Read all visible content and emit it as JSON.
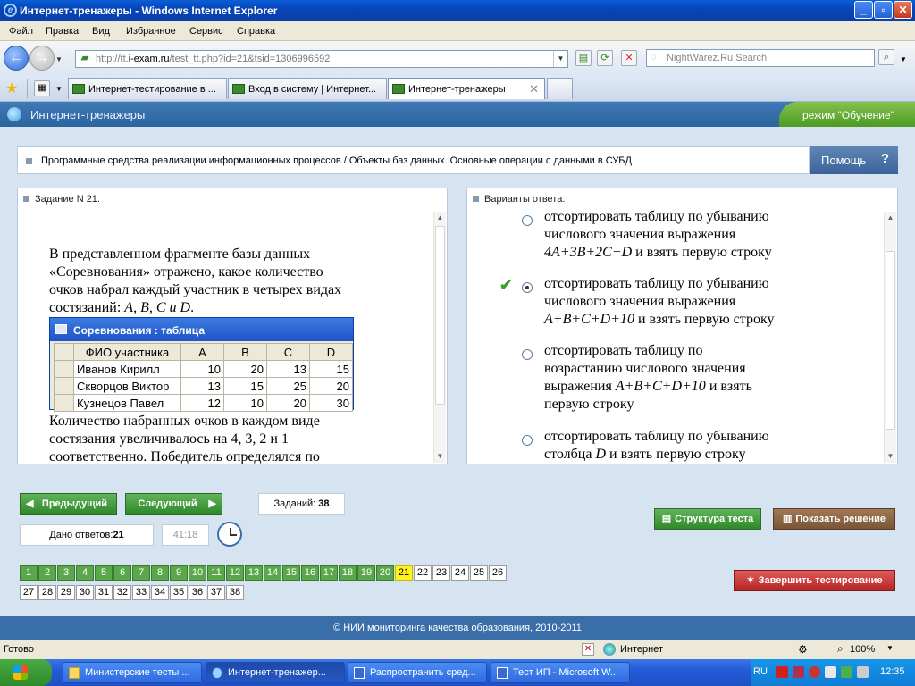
{
  "window": {
    "title": "Интернет-тренажеры - Windows Internet Explorer"
  },
  "menu": [
    "Файл",
    "Правка",
    "Вид",
    "Избранное",
    "Сервис",
    "Справка"
  ],
  "address": {
    "prefix": "http://tt.",
    "host": "i-exam.ru",
    "path": "/test_tt.php?id=21&tsid=1306996592"
  },
  "search": {
    "placeholder": "NightWarez.Ru Search"
  },
  "tabs": [
    {
      "label": "Интернет-тестирование в ..."
    },
    {
      "label": "Вход в систему | Интернет..."
    },
    {
      "label": "Интернет-тренажеры"
    }
  ],
  "app": {
    "title": "Интернет-тренажеры",
    "mode": "режим \"Обучение\""
  },
  "breadcrumb": "Программные средства реализации информационных процессов / Объекты баз данных. Основные операции с данными в СУБД",
  "help_label": "Помощь",
  "task": {
    "header": "Задание N 21.",
    "text_lines": [
      "В представленном  фрагменте базы данных",
      "«Соревнования» отражено, какое количество",
      "очков набрал каждый участник в четырех видах"
    ],
    "text_line4_prefix": "состязаний: ",
    "text_line4_math": "A, B, C и D",
    "text_line4_suffix": ".",
    "after_lines": [
      "Количество набранных очков в каждом виде",
      "состязания увеличивалось на 4, 3, 2 и 1",
      "соответственно. Победитель определялся по"
    ]
  },
  "table": {
    "title": "Соревнования : таблица",
    "columns": [
      "ФИО участника",
      "A",
      "B",
      "C",
      "D"
    ],
    "rows": [
      [
        "Иванов Кирилл",
        "10",
        "20",
        "13",
        "15"
      ],
      [
        "Скворцов Виктор",
        "13",
        "15",
        "25",
        "20"
      ],
      [
        "Кузнецов Павел",
        "12",
        "10",
        "20",
        "30"
      ]
    ]
  },
  "answers": {
    "header": "Варианты ответа:",
    "options": [
      {
        "l1": "отсортировать таблицу по убыванию",
        "l2": "числового значения выражения",
        "l3m": "4A+3B+2C+D",
        "l3s": " и взять первую строку",
        "selected": false
      },
      {
        "l1": "отсортировать таблицу по убыванию",
        "l2": "числового значения выражения",
        "l3m": "A+B+C+D+10",
        "l3s": " и взять первую строку",
        "selected": true
      },
      {
        "l1": "отсортировать таблицу по",
        "l2": "возрастанию числового значения",
        "l3p": "выражения ",
        "l3m": "A+B+C+D+10",
        "l3s": " и взять",
        "l4": "первую строку",
        "selected": false
      },
      {
        "l1": "отсортировать таблицу по убыванию",
        "l2p": "столбца ",
        "l2m": "D",
        "l2s": " и взять первую строку",
        "selected": false
      }
    ]
  },
  "controls": {
    "prev": "Предыдущий",
    "next": "Следующий",
    "tasks_label": "Заданий:",
    "tasks_count": "38",
    "answered_label": "Дано ответов:",
    "answered_count": "21",
    "timer": "41:18",
    "structure": "Структура теста",
    "show_solution": "Показать решение",
    "finish": "Завершить тестирование"
  },
  "question_numbers": {
    "total": 38,
    "done": 20,
    "current": 21
  },
  "footer": "© НИИ мониторинга качества образования, 2010-2011",
  "status": {
    "left": "Готово",
    "zone": "Интернет",
    "zoom": "100%"
  },
  "taskbar": {
    "items": [
      "Министерские тесты ...",
      "Интернет-тренажер...",
      "Распространить сред...",
      "Тест ИП - Microsoft W..."
    ],
    "lang": "RU",
    "clock": "12:35"
  }
}
